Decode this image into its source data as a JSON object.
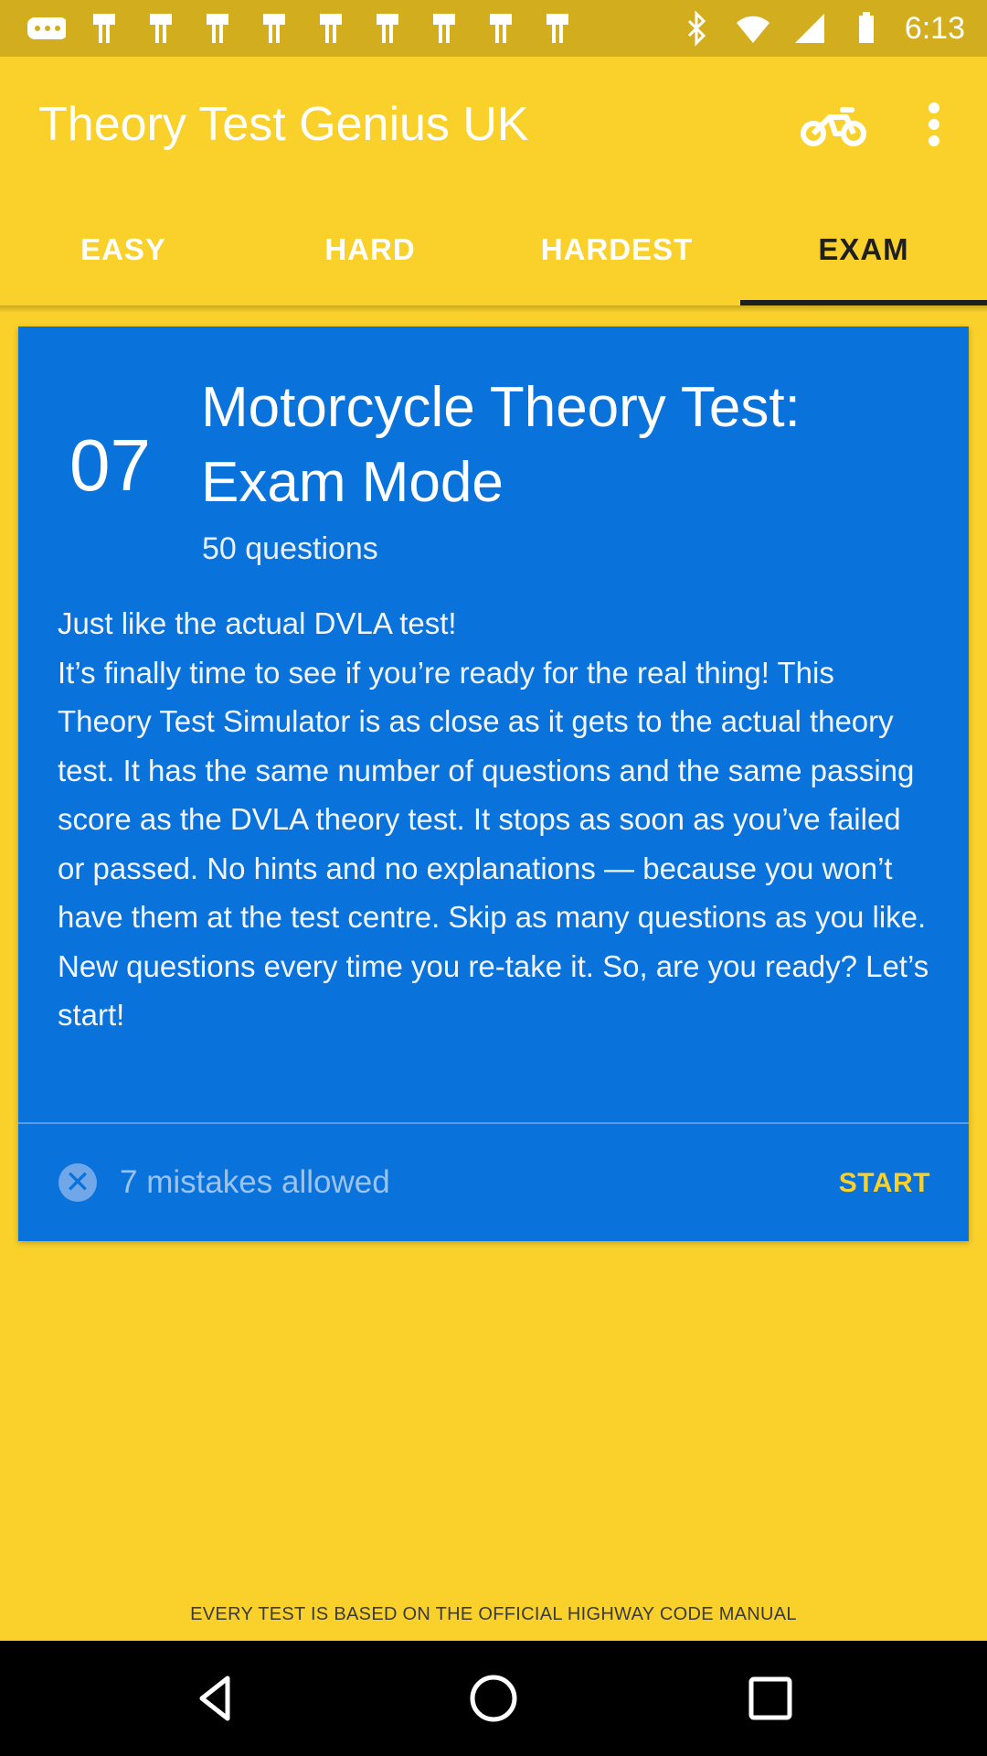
{
  "status_bar": {
    "time": "6:13",
    "left_icons": [
      "message-icon",
      "notification-icon",
      "notification-icon",
      "notification-icon",
      "notification-icon",
      "notification-icon",
      "notification-icon",
      "notification-icon",
      "notification-icon",
      "notification-icon"
    ],
    "right_icons": [
      "bluetooth-icon",
      "wifi-icon",
      "signal-icon",
      "battery-icon"
    ]
  },
  "app_bar": {
    "title": "Theory Test Genius UK",
    "actions": [
      "motorcycle-icon",
      "more-vert-icon"
    ]
  },
  "tabs": [
    {
      "label": "EASY",
      "active": false
    },
    {
      "label": "HARD",
      "active": false
    },
    {
      "label": "HARDEST",
      "active": false
    },
    {
      "label": "EXAM",
      "active": true
    }
  ],
  "card": {
    "number": "07",
    "title": "Motorcycle Theory Test: Exam Mode",
    "subtitle": "50 questions",
    "description": "Just like the actual DVLA test!\nIt’s finally time to see if you’re ready for the real thing! This Theory Test Simulator is as close as it gets to the actual theory test. It has the same number of questions and the same passing score as the DVLA theory test. It stops as soon as you’ve failed or passed. No hints and no explanations — because you won’t have them at the test centre. Skip as many questions as you like. New questions every time you re-take it. So, are you ready? Let’s start!",
    "mistakes_label": "7 mistakes allowed",
    "start_label": "START",
    "background_color": "#0A72DB"
  },
  "footer_note": "EVERY TEST IS BASED ON THE OFFICIAL HIGHWAY CODE MANUAL",
  "nav_bar": {
    "buttons": [
      "back-icon",
      "home-icon",
      "recents-icon"
    ]
  },
  "colors": {
    "app_background": "#F9D12A",
    "status_bar": "#D2AE1E",
    "accent": "#F9D12A",
    "card": "#0A72DB"
  }
}
